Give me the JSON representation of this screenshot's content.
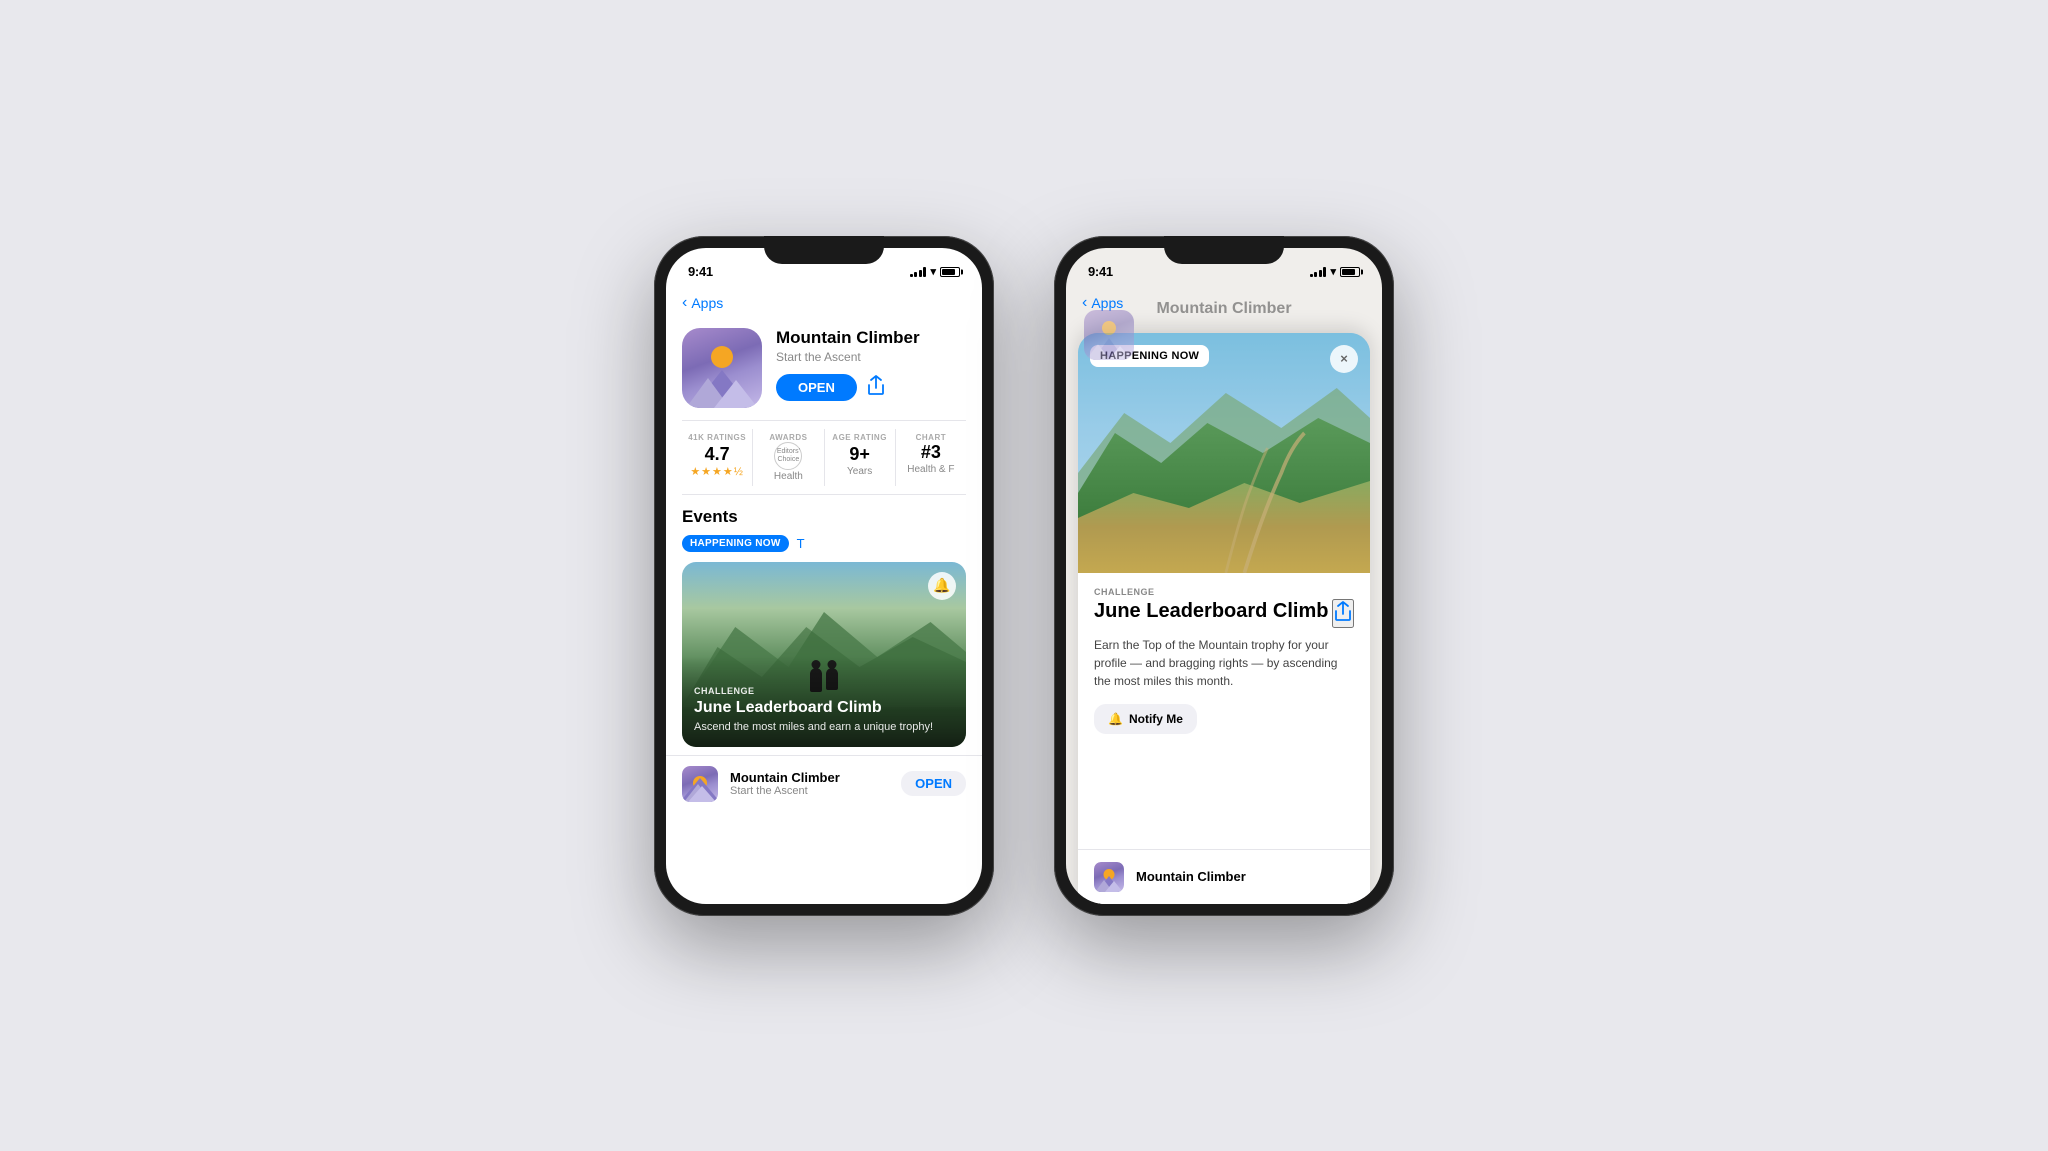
{
  "background": "#e8e8ed",
  "left_phone": {
    "status": {
      "time": "9:41",
      "signal": true,
      "wifi": true,
      "battery": true
    },
    "nav": {
      "back_label": "Apps"
    },
    "app": {
      "name": "Mountain Climber",
      "subtitle": "Start the Ascent",
      "open_button": "OPEN"
    },
    "stats": {
      "ratings_label": "41K RATINGS",
      "ratings_value": "4.7",
      "awards_label": "AWARDS",
      "awards_value": "Editors' Choice",
      "awards_sub": "Health",
      "age_label": "AGE RATING",
      "age_value": "9+",
      "age_sub": "Years",
      "chart_label": "CHART",
      "chart_value": "#3",
      "chart_sub": "Health & F"
    },
    "events": {
      "section_title": "Events",
      "filter_label": "HAPPENING NOW",
      "see_all": "T",
      "card": {
        "type": "CHALLENGE",
        "title": "June Leaderboard Climb",
        "desc": "Ascend the most miles and earn a unique trophy!"
      }
    },
    "bottom_card": {
      "name": "Mountain Climber",
      "subtitle": "Start the Ascent",
      "open_button": "OPEN"
    }
  },
  "right_phone": {
    "status": {
      "time": "9:41"
    },
    "nav": {
      "back_label": "Apps"
    },
    "app": {
      "name": "Mountain Climber"
    },
    "modal": {
      "happening_now": "HAPPENING NOW",
      "close_btn": "×",
      "event_type": "CHALLENGE",
      "event_title": "June Leaderboard Climb",
      "share_icon": "↑",
      "event_desc": "Earn the Top of the Mountain trophy for your profile — and bragging rights — by ascending the most miles this month.",
      "notify_button": "Notify Me",
      "notify_icon": "🔔"
    },
    "bottom": {
      "name": "Mountain Climber"
    }
  }
}
